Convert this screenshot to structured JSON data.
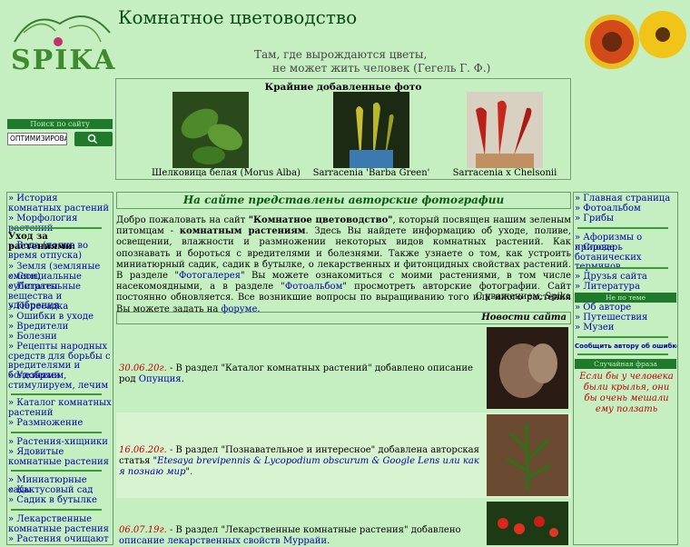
{
  "header": {
    "logo_text": "SPIKA",
    "title": "Комнатное цветоводство",
    "quote_line1": "Там, где вырождаются цветы,",
    "quote_line2": "не может жить человек (Гегель Г. Ф.)"
  },
  "search": {
    "title": "Поиск по сайту",
    "input_value": "ОПТИМИЗИРОВАН",
    "button_icon": "search-icon"
  },
  "recent": {
    "title": "Крайние добавленные фото",
    "photos": [
      {
        "caption": "Шелковица белая (Morus Alba)"
      },
      {
        "caption": "Sarracenia 'Barba Green'"
      },
      {
        "caption": "Sarracenia x Chelsonii"
      }
    ]
  },
  "left_menu": {
    "group1": [
      "» История комнатных растений",
      "» Морфология растений"
    ],
    "care_heading": "Уход за растениями:",
    "care": [
      "» Вода (полив во время отпуска)",
      "» Земля (земляные смеси)",
      "» Специальные субстраты",
      "» Питательные вещества и удобрения",
      "» Пересадка",
      "» Ошибки в уходе",
      "» Вредители",
      "» Болезни",
      "» Рецепты народных средств для борьбы с вредителями и болезнями",
      "» Удобряем, стимулируем, лечим"
    ],
    "group3": [
      "» Каталог комнатных растений",
      "» Размножение"
    ],
    "group4": [
      "» Растения-хищники",
      "» Ядовитые комнатные растения"
    ],
    "group5": [
      "» Миниатюрные сады",
      "» Кактусовый сад",
      "» Садик в бутылке"
    ],
    "group6": [
      "» Лекарственные комнатные растения",
      "» Растения очищают воздух"
    ]
  },
  "main": {
    "banner": "На сайте представлены авторские фотографии",
    "welcome": {
      "p1": "Добро пожаловать на сайт ",
      "site_name": "\"Комнатное цветоводство\"",
      "p2": ", который посвящен нашим зеленым питомцам - ",
      "bold2": "комнатным растениям",
      "p3": ". Здесь Вы найдете информацию об уходе, поливе, освещении, влажности и размножении некоторых видов комнатных растений. Как опознавать и бороться с вредителями и болезнями. Также узнаете о том, как устроить миниатюрный садик, садик в бутылке, о лекарственных и фитонцидных свойствах растений. В разделе \"",
      "link1": "Фотогалерея",
      "p4": "\" Вы можете ознакомиться с моими растениями, в том числе насекомоядными, а в разделе \"",
      "link2": "Фотоальбом",
      "p5": "\" просмотреть авторские фотографии. Сайт постоянно обновляется. Все возникшие вопросы по выращиванию того или иного растения Вы можете задать на ",
      "link3": "форуме",
      "p6": "."
    },
    "signature": "С уважением, Spika",
    "news_title": "Новости сайта",
    "news": [
      {
        "date": "30.06.20г.",
        "text": " - В раздел \"Каталог комнатных растений\" добавлено описание род ",
        "link": "Опунция",
        "end": "."
      },
      {
        "date": "16.06.20г.",
        "text": " - В раздел \"Познавательное и интересное\" добавлена авторская статья \"",
        "link": "Etesaya brevipennis & Lycopodium obscurum & Google Lens или как я познаю мир",
        "end": "\"."
      },
      {
        "date": "06.07.19г.",
        "text": " - В раздел \"Лекарственные комнатные растения\" добавлено ",
        "link": "описание лекарственных свойств Муррайи",
        "end": "."
      }
    ]
  },
  "right_menu": {
    "links1": [
      "» Главная страница",
      "» Фотоальбом",
      "» Грибы"
    ],
    "links2": [
      "» Афоризмы о природе",
      "» Словарь ботанических терминов"
    ],
    "links3": [
      "» Друзья сайта",
      "» Литература"
    ],
    "offtopic": "Не по теме",
    "links4": [
      "» Об авторе",
      "» Путешествия",
      "» Музеи"
    ],
    "report": "Сообщить автору об ошибке",
    "random_title": "Случайная фраза",
    "random_phrase": "Если бы у человека были крылья, они бы очень мешали ему ползать"
  }
}
